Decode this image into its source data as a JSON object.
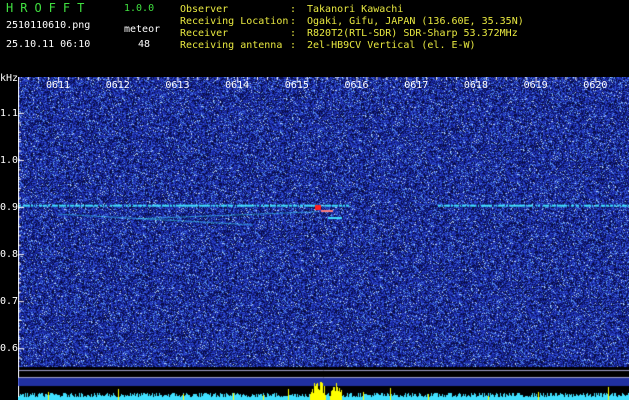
{
  "header": {
    "app_title": "HROFFT",
    "app_version": "1.0.0",
    "filename": "2510110610.png",
    "meteor_label": "meteor",
    "timestamp": "25.10.11 06:10",
    "meteor_count": "48"
  },
  "info": [
    {
      "key": "Observer",
      "value": "Takanori Kawachi"
    },
    {
      "key": "Receiving Location",
      "value": "Ogaki, Gifu, JAPAN (136.60E, 35.35N)"
    },
    {
      "key": "Receiver",
      "value": "R820T2(RTL-SDR) SDR-Sharp 53.372MHz"
    },
    {
      "key": "Receiving antenna",
      "value": "2el-HB9CV Vertical (el. E-W)"
    }
  ],
  "spectrogram": {
    "y_unit": "kHz",
    "y_ticks": [
      "1.1",
      "1.0",
      "0.9",
      "0.8",
      "0.7",
      "0.6"
    ],
    "y_range": [
      0.56,
      1.17
    ],
    "x_ticks": [
      "0611",
      "0612",
      "0613",
      "0614",
      "0615",
      "0616",
      "0617",
      "0618",
      "0619",
      "0620"
    ],
    "carrier_khz": 0.905,
    "meteor_khz": 0.9,
    "colors": {
      "background": "#000000",
      "noise": "#1a2aa0",
      "axis": "#ffffff",
      "signal": "#40e0ff",
      "hot": "#ff2020",
      "bars": "#ffff00"
    }
  }
}
